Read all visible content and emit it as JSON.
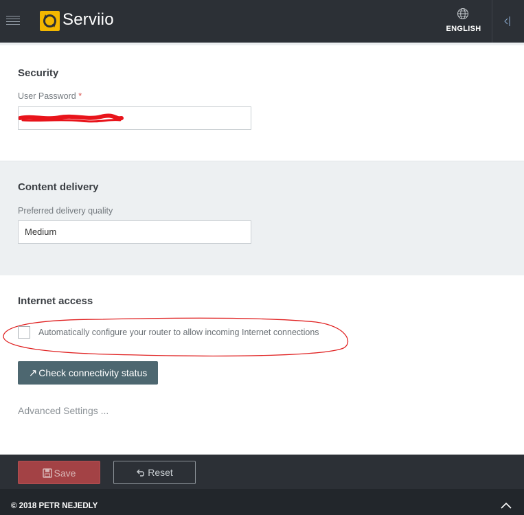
{
  "header": {
    "app_name": "Serviio",
    "language_label": "ENGLISH",
    "menu_icon": "hamburger-icon",
    "language_icon": "globe-icon",
    "collapse_icon": "collapse-panel-icon",
    "colors": {
      "bar": "#2c3036",
      "logo": "#f3b700"
    }
  },
  "security": {
    "title": "Security",
    "password_label": "User Password",
    "required_mark": "*",
    "password_value": ""
  },
  "content_delivery": {
    "title": "Content delivery",
    "quality_label": "Preferred delivery quality",
    "quality_value": "Medium"
  },
  "internet_access": {
    "title": "Internet access",
    "auto_configure_label": "Automatically configure your router to allow incoming Internet connections",
    "auto_configure_checked": false,
    "check_button_label": "Check connectivity status",
    "check_button_icon": "external-arrow-icon",
    "advanced_link": "Advanced Settings ..."
  },
  "actions": {
    "save_label": "Save",
    "save_icon": "floppy-disk-icon",
    "reset_label": "Reset",
    "reset_icon": "undo-arrow-icon",
    "colors": {
      "save": "#a34245",
      "check_button": "#4d6770"
    }
  },
  "footer": {
    "copyright": "© 2018 PETR NEJEDLY",
    "scroll_top_icon": "chevron-up-icon"
  }
}
